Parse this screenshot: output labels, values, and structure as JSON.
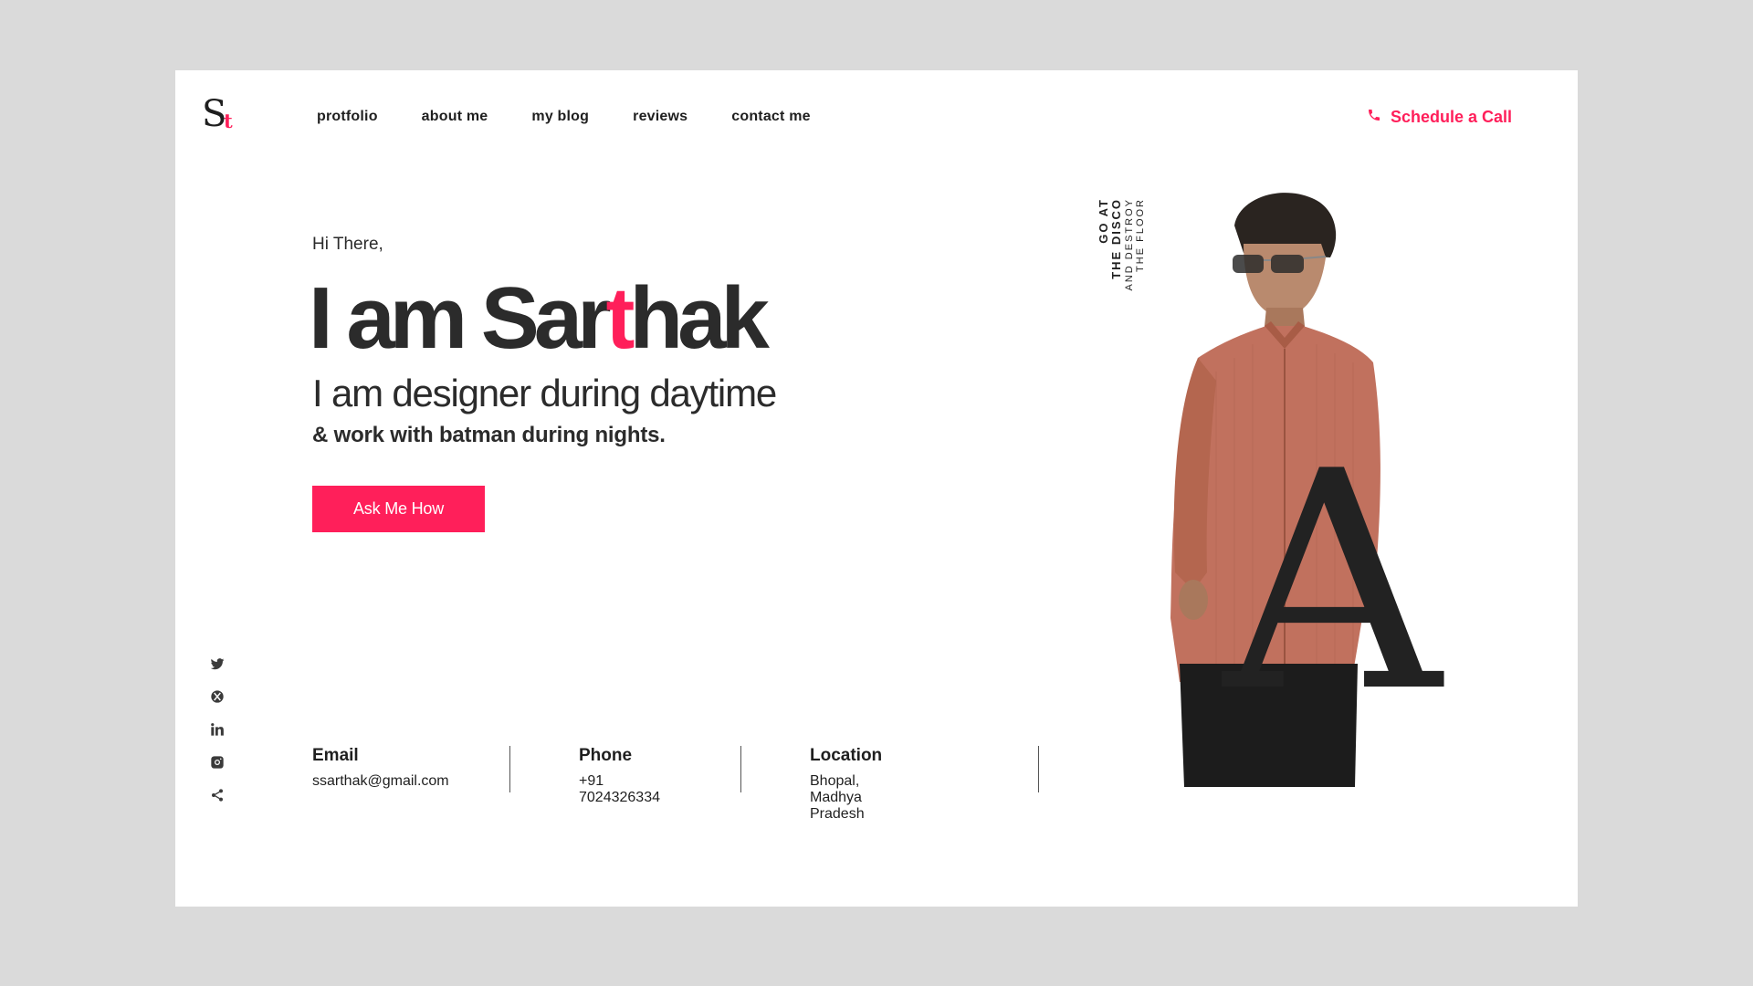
{
  "brand": {
    "logo_main": "S",
    "logo_accent": "t"
  },
  "nav": {
    "items": [
      {
        "label": "protfolio"
      },
      {
        "label": "about me"
      },
      {
        "label": "my blog"
      },
      {
        "label": "reviews"
      },
      {
        "label": "contact me"
      }
    ]
  },
  "header": {
    "schedule_label": "Schedule a Call"
  },
  "hero": {
    "greeting": "Hi There,",
    "headline_pre": "I am Sar",
    "headline_accent": "t",
    "headline_post": "hak",
    "subtitle": "I am designer during daytime",
    "subtitle2": "& work with batman during nights.",
    "cta_label": "Ask Me How"
  },
  "side_text": {
    "line1": "GO AT",
    "line2": "THE DISCO",
    "line3": "AND DESTROY",
    "line4": "THE FLOOR"
  },
  "decor": {
    "big_letter": "A"
  },
  "contacts": [
    {
      "label": "Email",
      "value": "ssarthak@gmail.com"
    },
    {
      "label": "Phone",
      "value": "+91 7024326334"
    },
    {
      "label": "Location",
      "value": "Bhopal, Madhya Pradesh"
    }
  ],
  "social": [
    "twitter-icon",
    "xbox-icon",
    "linkedin-icon",
    "instagram-icon",
    "share-icon"
  ],
  "colors": {
    "accent": "#ff1f5a",
    "text": "#2b2b2b",
    "page_bg": "#dadada",
    "card_bg": "#ffffff",
    "shirt": "#c1715e"
  }
}
